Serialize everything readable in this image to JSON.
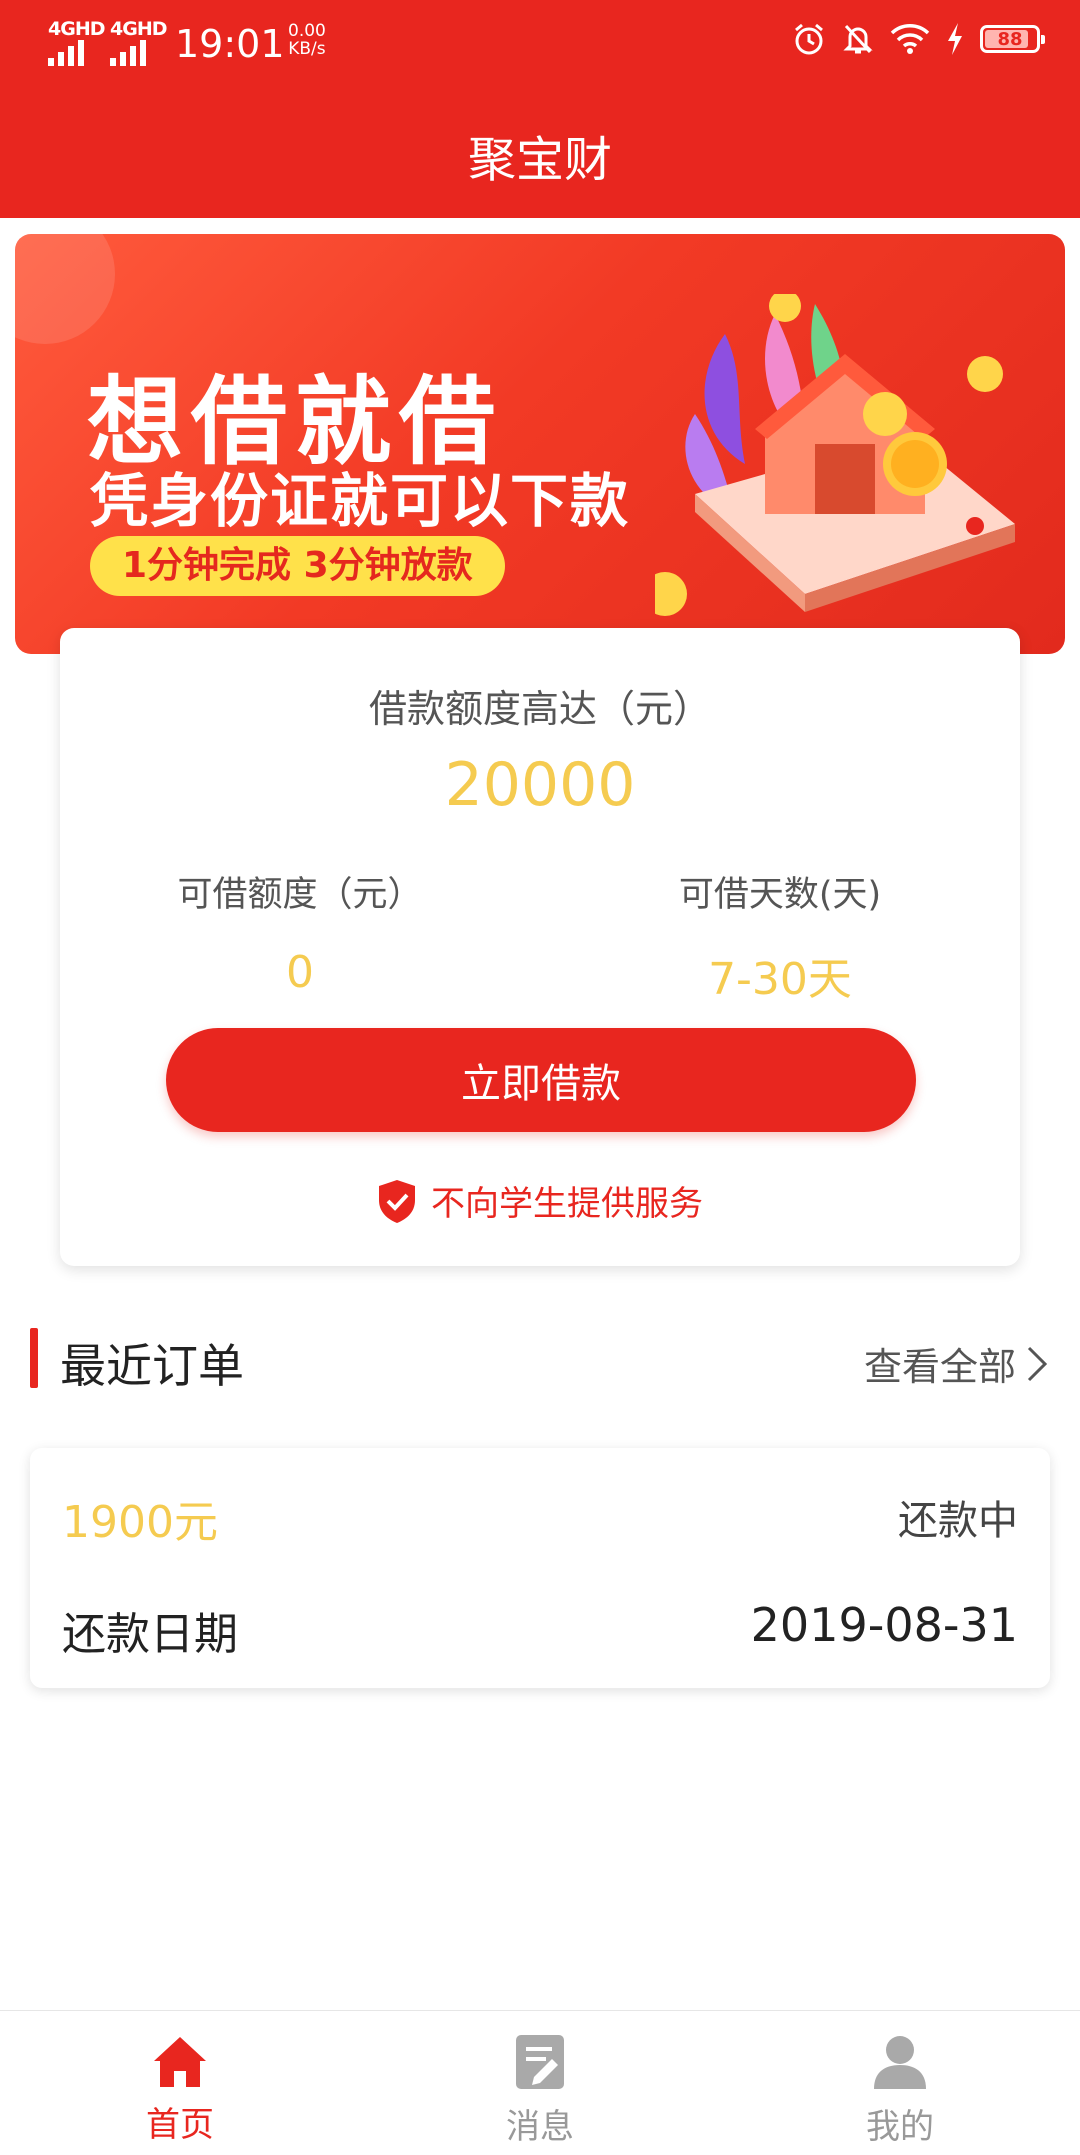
{
  "status_bar": {
    "signal1": "4GHD",
    "signal2": "4GHD",
    "time": "19:01",
    "net_speed": "0.00",
    "net_unit": "KB/s",
    "battery": "88"
  },
  "header": {
    "title": "聚宝财"
  },
  "banner": {
    "headline": "想借就借",
    "subline": "凭身份证就可以下款",
    "pill": "1分钟完成 3分钟放款"
  },
  "loan_card": {
    "max_label": "借款额度高达（元）",
    "max_amount": "20000",
    "available_label": "可借额度（元）",
    "available_value": "0",
    "days_label": "可借天数(天)",
    "days_value": "7-30天",
    "button": "立即借款",
    "notice": "不向学生提供服务"
  },
  "recent_orders": {
    "title": "最近订单",
    "view_all": "查看全部",
    "orders": [
      {
        "amount": "1900元",
        "status": "还款中",
        "date_label": "还款日期",
        "date": "2019-08-31"
      }
    ]
  },
  "bottom_nav": {
    "items": [
      {
        "label": "首页",
        "icon": "home-icon",
        "active": true
      },
      {
        "label": "消息",
        "icon": "message-icon",
        "active": false
      },
      {
        "label": "我的",
        "icon": "profile-icon",
        "active": false
      }
    ]
  },
  "colors": {
    "primary": "#E8261F",
    "accent_yellow": "#F5CB50",
    "inactive": "#999999"
  }
}
